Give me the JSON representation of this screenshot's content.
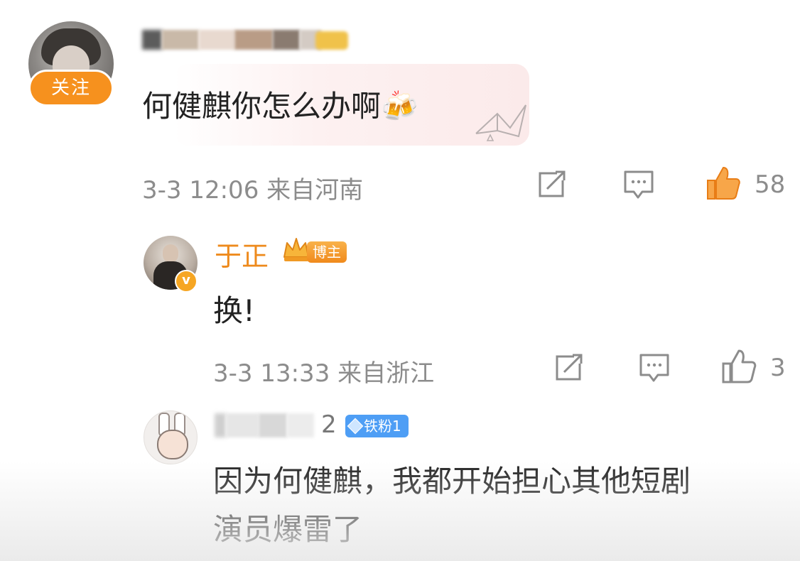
{
  "comments": [
    {
      "username": "",
      "follow_label": "关注",
      "text": "何健麒你怎么办啊🍻",
      "time": "3-3 12:06",
      "location": "来自河南",
      "likes": "58"
    }
  ],
  "replies": [
    {
      "username": "于正",
      "badge": "博主",
      "text": "换!",
      "time": "3-3 13:33",
      "location": "来自浙江",
      "likes": "3"
    },
    {
      "username_tail": "2",
      "badge": "铁粉1",
      "text_line1": "因为何健麒，我都开始担心其他短剧",
      "text_line2": "演员爆雷了"
    }
  ],
  "colors": {
    "accent_orange": "#f6911e",
    "like_orange": "#f0861f",
    "meta_gray": "#8c8c8c",
    "fan_blue": "#4e9ef5"
  },
  "icons": [
    "repost-icon",
    "comment-icon",
    "like-icon",
    "crown-icon",
    "verified-icon",
    "diamond-icon"
  ]
}
